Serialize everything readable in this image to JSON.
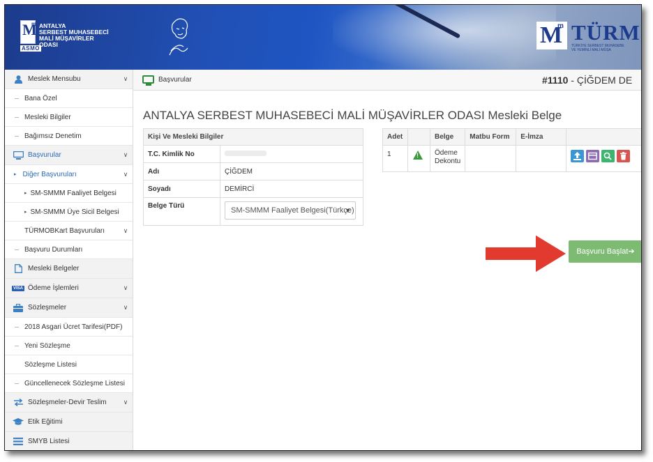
{
  "header": {
    "logo_lines": [
      "ANTALYA",
      "SERBEST MUHASEBECİ",
      "MALİ MÜŞAVİRLER",
      "ODASI"
    ],
    "logo_asmo": "ASMO",
    "turmob_text": "TÜRM",
    "turmob_sub": "TÜRKİYE SERBEST MUHASEBE\nVE YEMİNLİ MALİ MÜŞA"
  },
  "sidebar": {
    "items": [
      {
        "label": "Meslek Mensubu",
        "icon": "user-icon"
      },
      {
        "label": "Bana Özel"
      },
      {
        "label": "Mesleki Bilgiler"
      },
      {
        "label": "Bağımsız Denetim"
      },
      {
        "label": "Başvurular",
        "icon": "monitor-icon"
      },
      {
        "label": "Diğer Başvuruları"
      },
      {
        "label": "SM-SMMM Faaliyet Belgesi"
      },
      {
        "label": "SM-SMMM Üye Sicil Belgesi"
      },
      {
        "label": "TÜRMOBKart Başvuruları"
      },
      {
        "label": "Başvuru Durumları"
      },
      {
        "label": "Mesleki Belgeler",
        "icon": "document-icon"
      },
      {
        "label": "Ödeme İşlemleri",
        "icon": "visa-icon"
      },
      {
        "label": "Sözleşmeler",
        "icon": "briefcase-icon"
      },
      {
        "label": "2018 Asgari Ücret Tarifesi(PDF)"
      },
      {
        "label": "Yeni Sözleşme"
      },
      {
        "label": "Sözleşme Listesi"
      },
      {
        "label": "Güncellenecek Sözleşme Listesi"
      },
      {
        "label": "Sözleşmeler-Devir Teslim",
        "icon": "exchange-icon"
      },
      {
        "label": "Etik Eğitimi",
        "icon": "graduation-cap-icon"
      },
      {
        "label": "SMYB Listesi",
        "icon": "list-icon"
      }
    ]
  },
  "main": {
    "breadcrumb": "Başvurular",
    "user_id": "#1110",
    "user_name": " - ÇİĞDEM DE",
    "page_title": "ANTALYA SERBEST MUHASEBECİ MALİ MÜŞAVİRLER ODASI Mesleki Belge",
    "person": {
      "header": "Kişi Ve Mesleki Bilgiler",
      "rows": [
        {
          "key": "T.C. Kimlik No",
          "value": ""
        },
        {
          "key": "Adı",
          "value": "ÇİĞDEM"
        },
        {
          "key": "Soyadı",
          "value": "DEMİRCİ"
        },
        {
          "key": "Belge Türü",
          "value": "SM-SMMM Faaliyet Belgesi(Türkçe)"
        }
      ]
    },
    "documents": {
      "headers": [
        "Adet",
        "",
        "Belge",
        "Matbu Form",
        "E-İmza",
        ""
      ],
      "rows": [
        {
          "adet": "1",
          "belge": "Ödeme Dekontu",
          "matbu": "",
          "eimza": ""
        }
      ]
    },
    "start_button": "Başvuru Başlat➔"
  }
}
